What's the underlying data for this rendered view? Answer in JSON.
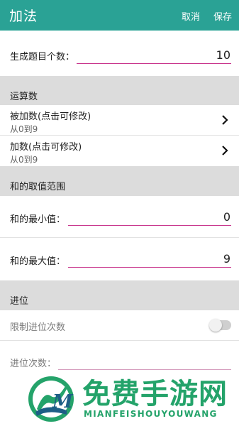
{
  "app_bar": {
    "title": "加法",
    "cancel_label": "取消",
    "save_label": "保存",
    "background_color": "#2aa295"
  },
  "question_count": {
    "label": "生成题目个数：",
    "value": "10"
  },
  "operands_section": {
    "title": "运算数",
    "items": [
      {
        "label": "被加数(点击可修改)",
        "range": "从0到9",
        "icon": "chevron-right-icon"
      },
      {
        "label": "加数(点击可修改)",
        "range": "从0到9",
        "icon": "chevron-right-icon"
      }
    ]
  },
  "sum_range_section": {
    "title": "和的取值范围",
    "min_label": "和的最小值：",
    "min_value": "0",
    "max_label": "和的最大值：",
    "max_value": "9"
  },
  "carry_section": {
    "title": "进位",
    "limit_label": "限制进位次数",
    "limit_enabled": false,
    "count_label": "进位次数：",
    "count_value": ""
  },
  "watermark": {
    "brand": "免费手游网",
    "subtitle": "MIANFEISHOUYOUWANG",
    "color": "#24a36a"
  },
  "accent_underline_color": "#c8348c"
}
